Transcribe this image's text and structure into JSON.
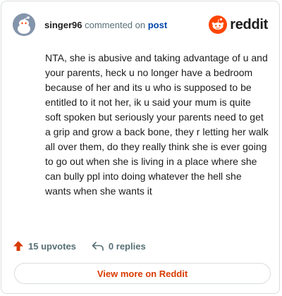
{
  "header": {
    "username": "singer96",
    "action_text": "commented on",
    "post_link": "post",
    "brand_name": "reddit"
  },
  "comment": {
    "text": "NTA, she is abusive and taking advantage of u and your parents, heck u no longer have a bedroom because of her and its u who is supposed to be entitled to it not her, ik u said your mum is quite soft spoken but seriously your parents need to get a grip and grow a back bone, they r letting her walk all over them, do they really think she is ever going to go out when she is living in a place where she can bully ppl into doing whatever the hell she wants when she wants it"
  },
  "footer": {
    "upvotes": "15 upvotes",
    "replies": "0 replies",
    "view_more": "View more on Reddit"
  },
  "colors": {
    "brand_orange": "#ff4500",
    "upvote": "#d93a00",
    "link": "#0045ac"
  },
  "icons": {
    "avatar": "snoo-avatar-icon",
    "brand": "reddit-logo-icon",
    "upvote": "upvote-arrow-icon",
    "reply": "reply-arrow-icon"
  }
}
